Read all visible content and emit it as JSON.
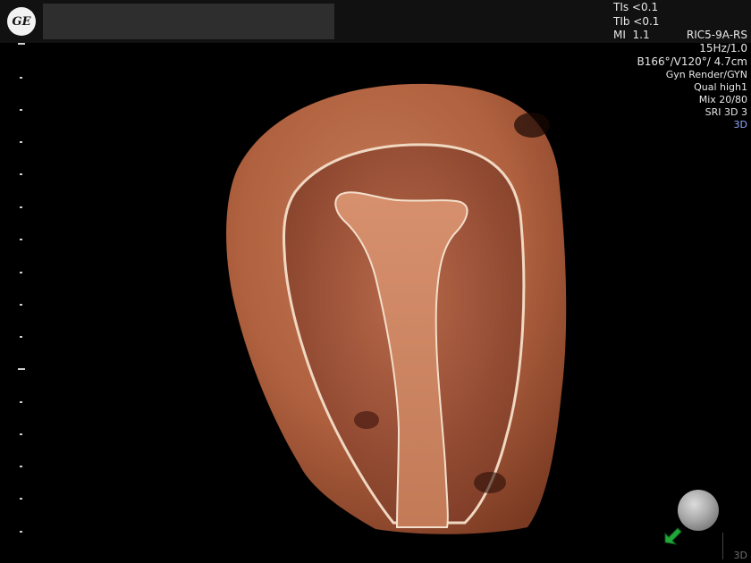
{
  "header": {
    "logo_text": "GE",
    "indices": {
      "tis": "TIs <0.1",
      "tib": "TIb <0.1",
      "mi": "MI  1.1"
    }
  },
  "params": {
    "probe": "RIC5-9A-RS",
    "frame_rate": "15Hz/1.0",
    "volume_angles": "B166°/V120°/ 4.7cm",
    "render_mode": "Gyn Render/GYN",
    "quality": "Qual high1",
    "mix": "Mix 20/80",
    "sri": "SRI 3D 3",
    "mode": "3D"
  },
  "corner": {
    "mode_label": "3D"
  },
  "colors": {
    "background": "#000000",
    "top_bar": "#111111",
    "tissue": "#b86a48",
    "mode_accent": "#8ea8ff",
    "orientation_arrow": "#22a83a"
  },
  "icons": {
    "logo": "ge-logo-icon",
    "orientation": "orientation-sphere-icon",
    "arrow": "orientation-arrow-icon"
  }
}
